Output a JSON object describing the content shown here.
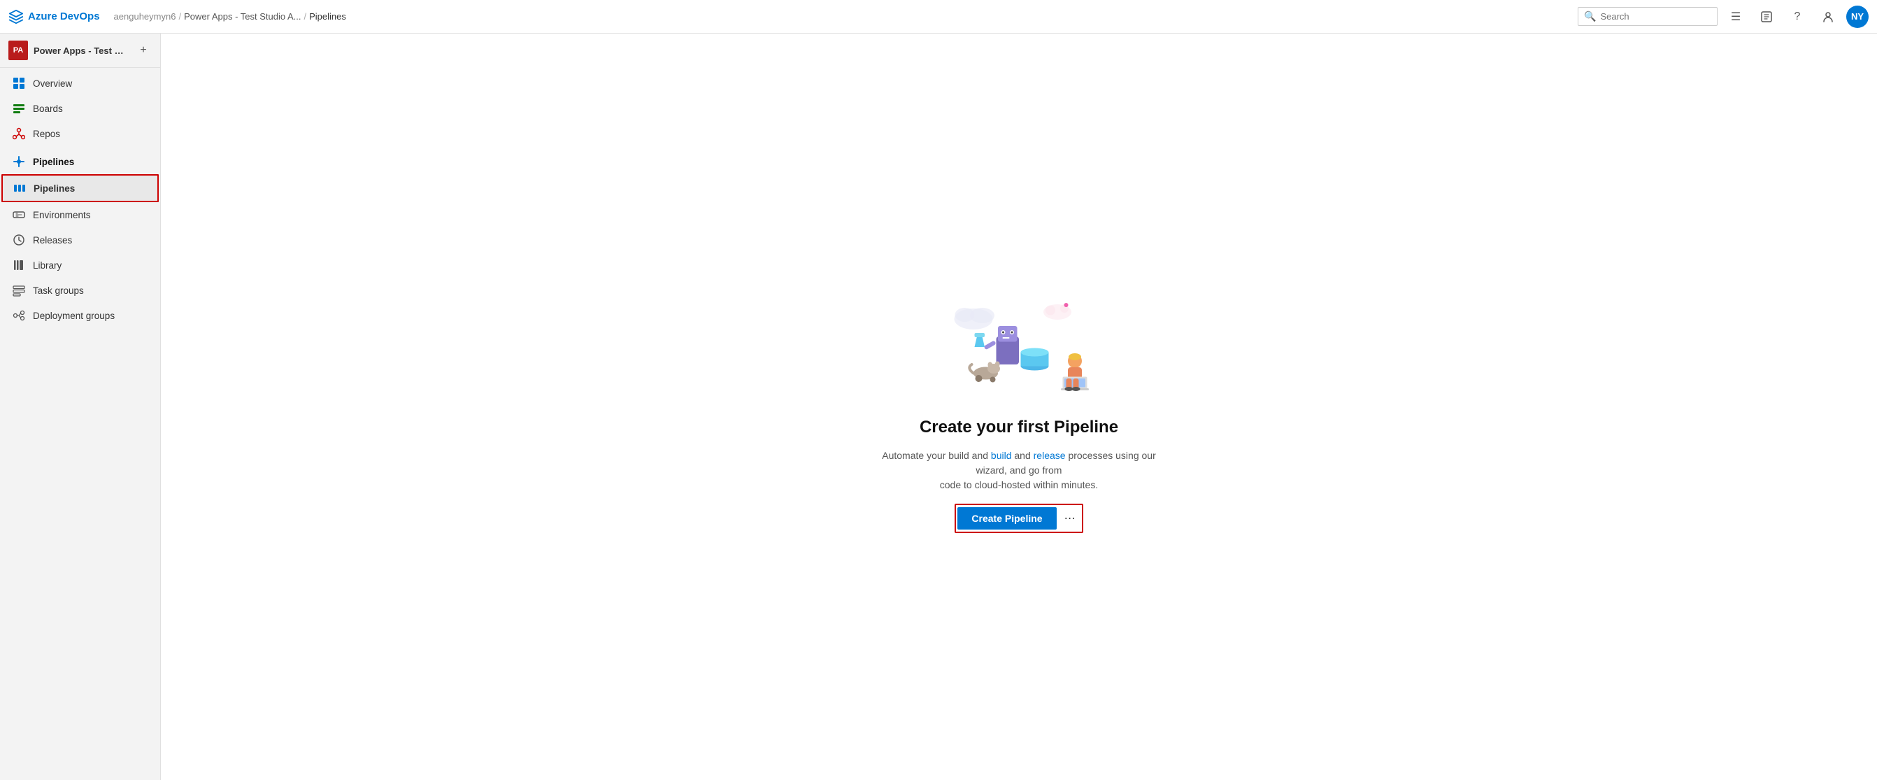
{
  "app": {
    "name": "Azure DevOps",
    "logo_initials": "AzDO"
  },
  "topbar": {
    "org_name": "aenguheymyn6",
    "project_name": "Power Apps - Test Studio A...",
    "current_page": "Pipelines",
    "search_placeholder": "Search",
    "icons": {
      "list": "≡",
      "badge": "🛍",
      "help": "?",
      "user": "👤"
    },
    "avatar_label": "NY"
  },
  "sidebar": {
    "project_avatar": "PA",
    "project_name": "Power Apps - Test Stud...",
    "nav_items": [
      {
        "id": "overview",
        "label": "Overview",
        "icon": "overview"
      },
      {
        "id": "boards",
        "label": "Boards",
        "icon": "boards"
      },
      {
        "id": "repos",
        "label": "Repos",
        "icon": "repos"
      },
      {
        "id": "pipelines-header",
        "label": "Pipelines",
        "icon": "pipelines-header",
        "is_header": true
      },
      {
        "id": "pipelines",
        "label": "Pipelines",
        "icon": "pipelines",
        "highlighted": true
      },
      {
        "id": "environments",
        "label": "Environments",
        "icon": "environments"
      },
      {
        "id": "releases",
        "label": "Releases",
        "icon": "releases"
      },
      {
        "id": "library",
        "label": "Library",
        "icon": "library"
      },
      {
        "id": "task-groups",
        "label": "Task groups",
        "icon": "task-groups"
      },
      {
        "id": "deployment-groups",
        "label": "Deployment groups",
        "icon": "deployment-groups"
      }
    ]
  },
  "main": {
    "title": "Create your first Pipeline",
    "description_part1": "Automate your build and ",
    "description_link1": "build",
    "description_part2": " and release processes using our wizard, and go from\ncode to cloud-hosted within minutes.",
    "description_link2": "release",
    "create_button_label": "Create Pipeline"
  }
}
